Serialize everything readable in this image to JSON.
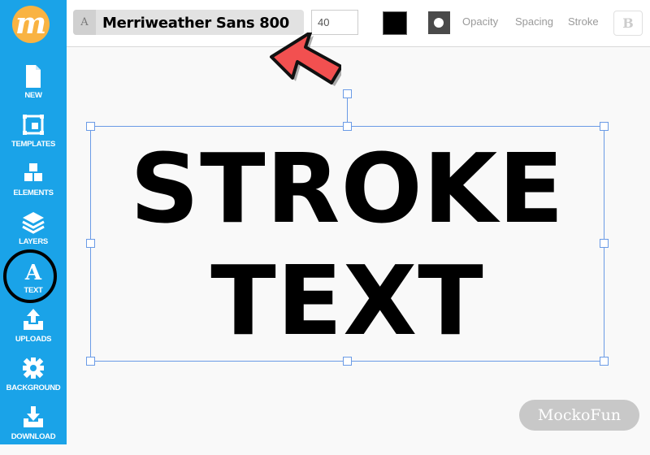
{
  "app": {
    "logo_letter": "m",
    "logo_color": "#f9b342",
    "sidebar_color": "#1aa3e8",
    "watermark": "MockoFun"
  },
  "sidebar": {
    "items": [
      {
        "label": "NEW",
        "icon": "file-icon"
      },
      {
        "label": "TEMPLATES",
        "icon": "templates-icon"
      },
      {
        "label": "ELEMENTS",
        "icon": "cubes-icon"
      },
      {
        "label": "LAYERS",
        "icon": "layers-icon"
      },
      {
        "label": "TEXT",
        "icon": "text-icon",
        "highlighted": true
      },
      {
        "label": "UPLOADS",
        "icon": "upload-icon"
      },
      {
        "label": "BACKGROUND",
        "icon": "gear-icon"
      },
      {
        "label": "DOWNLOAD",
        "icon": "download-icon"
      }
    ]
  },
  "toolbar": {
    "font_icon": "A",
    "font_name": "Merriweather Sans 800",
    "font_size": "40",
    "text_color": "#000000",
    "opacity_label": "Opacity",
    "spacing_label": "Spacing",
    "stroke_label": "Stroke",
    "bold_label": "B"
  },
  "canvas": {
    "text_lines": [
      "STROKE",
      "TEXT"
    ],
    "selection_color": "#6b9be6",
    "arrow_color": "#f25050"
  }
}
